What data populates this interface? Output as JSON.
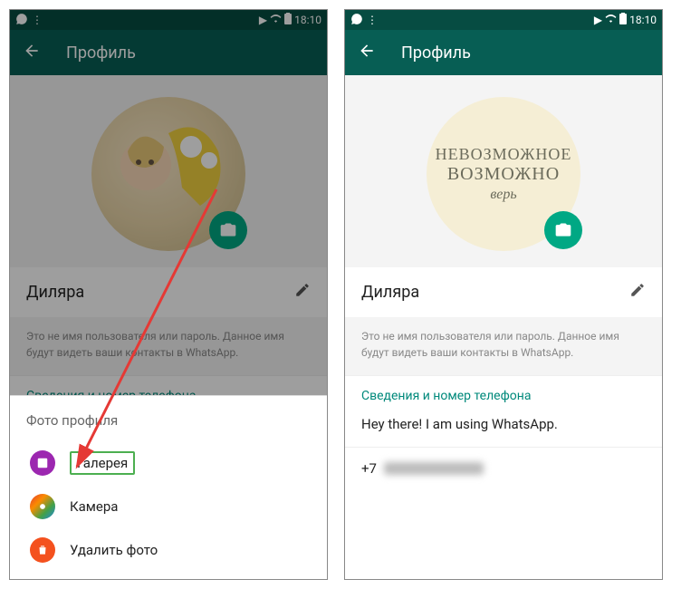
{
  "status": {
    "time": "18:10"
  },
  "header": {
    "title": "Профиль"
  },
  "profile": {
    "name": "Диляра",
    "helper": "Это не имя пользователя или пароль. Данное имя будут видеть ваши контакты в WhatsApp.",
    "section_title": "Сведения и номер телефона",
    "about": "Hey there! I am using WhatsApp.",
    "phone_prefix": "+7"
  },
  "avatar_quote": {
    "line1": "НЕВОЗМОЖНОЕ",
    "line2": "ВОЗМОЖНО",
    "line3": "верь"
  },
  "sheet": {
    "title": "Фото профиля",
    "gallery": "Галерея",
    "camera": "Камера",
    "delete": "Удалить фото"
  }
}
